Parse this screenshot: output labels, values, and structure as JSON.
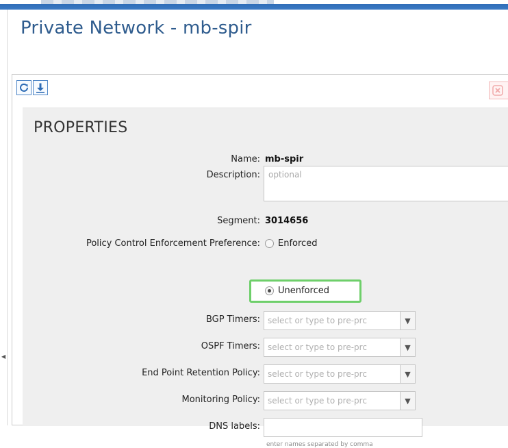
{
  "page": {
    "title": "Private Network - mb-spir"
  },
  "toolbar": {
    "refresh_icon": "refresh-icon",
    "download_icon": "download-icon",
    "close_icon": "close-icon"
  },
  "properties": {
    "heading": "PROPERTIES",
    "name_label": "Name:",
    "name_value": "mb-spir",
    "description_label": "Description:",
    "description_placeholder": "optional",
    "segment_label": "Segment:",
    "segment_value": "3014656",
    "policy_label": "Policy Control Enforcement Preference:",
    "policy_options": [
      {
        "label": "Enforced",
        "selected": false
      },
      {
        "label": "Unenforced",
        "selected": true
      }
    ],
    "bgp_label": "BGP Timers:",
    "bgp_placeholder": "select or type to pre-prc",
    "ospf_label": "OSPF Timers:",
    "ospf_placeholder": "select or type to pre-prc",
    "endpoint_label": "End Point Retention Policy:",
    "endpoint_placeholder": "select or type to pre-prc",
    "monitoring_label": "Monitoring Policy:",
    "monitoring_placeholder": "select or type to pre-prc",
    "dns_label": "DNS labels:",
    "dns_value": "",
    "dns_hint": "enter names separated by comma"
  },
  "colors": {
    "title": "#2f5c8e",
    "highlight": "#6ecf6a",
    "button_border": "#4f86c6",
    "close_border": "#f1b7b7"
  }
}
